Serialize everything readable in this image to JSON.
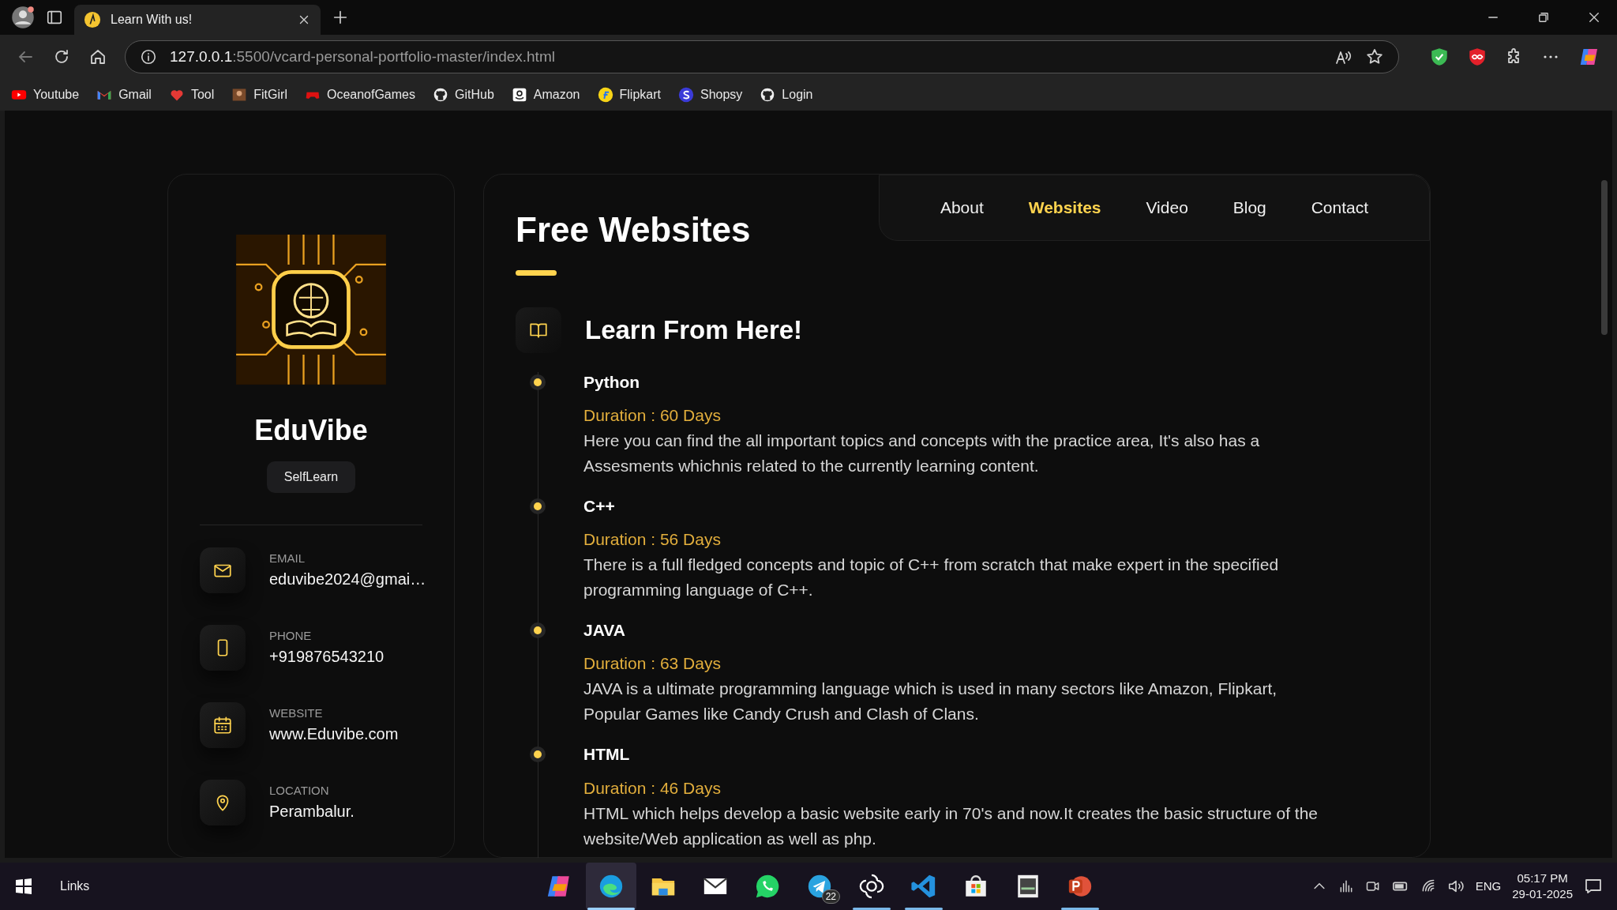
{
  "browser": {
    "tabs": [
      {
        "title": "Learn With us!",
        "selected": true
      }
    ],
    "address": {
      "host": "127.0.0.1",
      "path": ":5500/vcard-personal-portfolio-master/index.html"
    },
    "bookmarks": [
      {
        "label": "Youtube",
        "kind": "youtube"
      },
      {
        "label": "Gmail",
        "kind": "gmail"
      },
      {
        "label": "Tool",
        "kind": "heart"
      },
      {
        "label": "FitGirl",
        "kind": "photo"
      },
      {
        "label": "OceanofGames",
        "kind": "gamepad"
      },
      {
        "label": "GitHub",
        "kind": "github"
      },
      {
        "label": "Amazon",
        "kind": "amazon"
      },
      {
        "label": "Flipkart",
        "kind": "flipkart"
      },
      {
        "label": "Shopsy",
        "kind": "shopsy"
      },
      {
        "label": "Login",
        "kind": "github"
      }
    ]
  },
  "sidebar": {
    "name": "EduVibe",
    "role": "SelfLearn",
    "contacts": [
      {
        "label": "EMAIL",
        "value": "eduvibe2024@gmai…",
        "kind": "email"
      },
      {
        "label": "PHONE",
        "value": "+919876543210",
        "kind": "phone"
      },
      {
        "label": "WEBSITE",
        "value": "www.Eduvibe.com",
        "kind": "calendar"
      },
      {
        "label": "LOCATION",
        "value": "Perambalur.",
        "kind": "location"
      }
    ]
  },
  "nav": [
    {
      "label": "About",
      "selected": false
    },
    {
      "label": "Websites",
      "selected": true
    },
    {
      "label": "Video",
      "selected": false
    },
    {
      "label": "Blog",
      "selected": false
    },
    {
      "label": "Contact",
      "selected": false
    }
  ],
  "article": {
    "title": "Free Websites",
    "section": "Learn From Here!",
    "items": [
      {
        "title": "Python",
        "duration": "Duration : 60 Days",
        "text": "Here you can find the all important topics and concepts with the practice area, It's also has a Assesments whichnis related to the currently learning content."
      },
      {
        "title": "C++",
        "duration": "Duration : 56 Days",
        "text": "There is a full fledged concepts and topic of C++ from scratch that make expert in the specified programming language of C++."
      },
      {
        "title": "JAVA",
        "duration": "Duration : 63 Days",
        "text": "JAVA is a ultimate programming language which is used in many sectors like Amazon, Flipkart, Popular Games like Candy Crush and Clash of Clans."
      },
      {
        "title": "HTML",
        "duration": "Duration : 46 Days",
        "text": "HTML which helps develop a basic website early in 70's and now.It creates the basic structure of the website/Web application as well as php."
      }
    ]
  },
  "taskbar": {
    "start_label": "Links",
    "apps": [
      {
        "kind": "copilot",
        "running": false,
        "selected": false
      },
      {
        "kind": "edge",
        "running": true,
        "selected": true
      },
      {
        "kind": "folder",
        "running": false,
        "selected": false
      },
      {
        "kind": "mail",
        "running": false,
        "selected": false
      },
      {
        "kind": "whatsapp",
        "running": false,
        "selected": false
      },
      {
        "kind": "telegram",
        "running": false,
        "selected": false,
        "badge": "22"
      },
      {
        "kind": "chatgpt",
        "running": true,
        "selected": false
      },
      {
        "kind": "vscode",
        "running": true,
        "selected": false
      },
      {
        "kind": "store",
        "running": false,
        "selected": false
      },
      {
        "kind": "game",
        "running": false,
        "selected": false
      },
      {
        "kind": "powerpoint",
        "running": true,
        "selected": false
      }
    ],
    "tray": {
      "language": "ENG",
      "time": "05:17 PM",
      "date": "29-01-2025"
    }
  }
}
